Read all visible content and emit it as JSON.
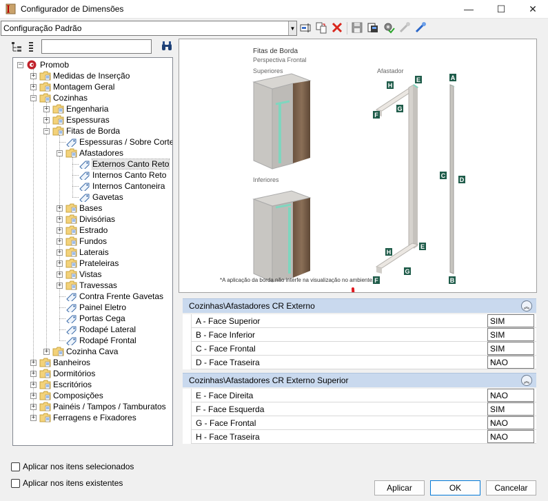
{
  "window": {
    "title": "Configurador de Dimensões",
    "minimize": "—",
    "maximize": "☐",
    "close": "✕"
  },
  "toolbar": {
    "config_value": "Configuração Padrão"
  },
  "search": {
    "placeholder": ""
  },
  "tree": {
    "items": [
      {
        "label": "Promob",
        "level": 0,
        "exp": "−",
        "icon": "promob"
      },
      {
        "label": "Medidas de Inserção",
        "level": 1,
        "exp": "+",
        "icon": "folder"
      },
      {
        "label": "Montagem Geral",
        "level": 1,
        "exp": "+",
        "icon": "folder"
      },
      {
        "label": "Cozinhas",
        "level": 1,
        "exp": "−",
        "icon": "folder"
      },
      {
        "label": "Engenharia",
        "level": 2,
        "exp": "+",
        "icon": "folder"
      },
      {
        "label": "Espessuras",
        "level": 2,
        "exp": "+",
        "icon": "folder"
      },
      {
        "label": "Fitas de Borda",
        "level": 2,
        "exp": "−",
        "icon": "folder"
      },
      {
        "label": "Espessuras / Sobre Corte",
        "level": 3,
        "exp": "",
        "icon": "tag"
      },
      {
        "label": "Afastadores",
        "level": 3,
        "exp": "−",
        "icon": "folder"
      },
      {
        "label": "Externos Canto Reto",
        "level": 4,
        "exp": "",
        "icon": "tag",
        "selected": true
      },
      {
        "label": "Internos Canto Reto",
        "level": 4,
        "exp": "",
        "icon": "tag"
      },
      {
        "label": "Internos Cantoneira",
        "level": 4,
        "exp": "",
        "icon": "tag"
      },
      {
        "label": "Gavetas",
        "level": 4,
        "exp": "",
        "icon": "tag"
      },
      {
        "label": "Bases",
        "level": 3,
        "exp": "+",
        "icon": "folder"
      },
      {
        "label": "Divisórias",
        "level": 3,
        "exp": "+",
        "icon": "folder"
      },
      {
        "label": "Estrado",
        "level": 3,
        "exp": "+",
        "icon": "folder"
      },
      {
        "label": "Fundos",
        "level": 3,
        "exp": "+",
        "icon": "folder"
      },
      {
        "label": "Laterais",
        "level": 3,
        "exp": "+",
        "icon": "folder"
      },
      {
        "label": "Prateleiras",
        "level": 3,
        "exp": "+",
        "icon": "folder"
      },
      {
        "label": "Vistas",
        "level": 3,
        "exp": "+",
        "icon": "folder"
      },
      {
        "label": "Travessas",
        "level": 3,
        "exp": "+",
        "icon": "folder"
      },
      {
        "label": "Contra Frente Gavetas",
        "level": 3,
        "exp": "",
        "icon": "tag"
      },
      {
        "label": "Painel Eletro",
        "level": 3,
        "exp": "",
        "icon": "tag"
      },
      {
        "label": "Portas Cega",
        "level": 3,
        "exp": "",
        "icon": "tag"
      },
      {
        "label": "Rodapé Lateral",
        "level": 3,
        "exp": "",
        "icon": "tag"
      },
      {
        "label": "Rodapé Frontal",
        "level": 3,
        "exp": "",
        "icon": "tag"
      },
      {
        "label": "Cozinha Cava",
        "level": 2,
        "exp": "+",
        "icon": "folder"
      },
      {
        "label": "Banheiros",
        "level": 1,
        "exp": "+",
        "icon": "folder"
      },
      {
        "label": "Dormitórios",
        "level": 1,
        "exp": "+",
        "icon": "folder"
      },
      {
        "label": "Escritórios",
        "level": 1,
        "exp": "+",
        "icon": "folder"
      },
      {
        "label": "Composições",
        "level": 1,
        "exp": "+",
        "icon": "folder"
      },
      {
        "label": "Painéis / Tampos / Tamburatos",
        "level": 1,
        "exp": "+",
        "icon": "folder"
      },
      {
        "label": "Ferragens e Fixadores",
        "level": 1,
        "exp": "+",
        "icon": "folder"
      }
    ]
  },
  "preview": {
    "title": "Fitas de Borda",
    "subtitle": "Perspectiva Frontal",
    "superiores": "Superiores",
    "inferiores": "Inferiores",
    "afastador": "Afastador",
    "note": "*A aplicação da borda não interfe na visualização no ambiente.",
    "letters": {
      "A": "A",
      "B": "B",
      "C": "C",
      "D": "D",
      "E": "E",
      "F": "F",
      "G": "G",
      "H": "H"
    }
  },
  "sections": [
    {
      "title": "Cozinhas\\Afastadores CR Externo",
      "rows": [
        {
          "label": "A - Face Superior",
          "value": "SIM"
        },
        {
          "label": "B - Face Inferior",
          "value": "SIM"
        },
        {
          "label": "C - Face Frontal",
          "value": "SIM"
        },
        {
          "label": "D - Face Traseira",
          "value": "NAO"
        }
      ]
    },
    {
      "title": "Cozinhas\\Afastadores CR Externo Superior",
      "rows": [
        {
          "label": "E - Face Direita",
          "value": "NAO"
        },
        {
          "label": "F - Face Esquerda",
          "value": "SIM"
        },
        {
          "label": "G - Face Frontal",
          "value": "NAO"
        },
        {
          "label": "H - Face Traseira",
          "value": "NAO"
        }
      ]
    }
  ],
  "options": {
    "apply_selected": "Aplicar nos itens selecionados",
    "apply_existing": "Aplicar nos itens existentes"
  },
  "buttons": {
    "apply": "Aplicar",
    "ok": "OK",
    "cancel": "Cancelar"
  },
  "colors": {
    "accent": "#0078d7",
    "section_header": "#c9d9ee",
    "edge_green": "#7fd6bf",
    "tag_green": "#1f5c4a",
    "arrow_red": "#e0191f"
  }
}
